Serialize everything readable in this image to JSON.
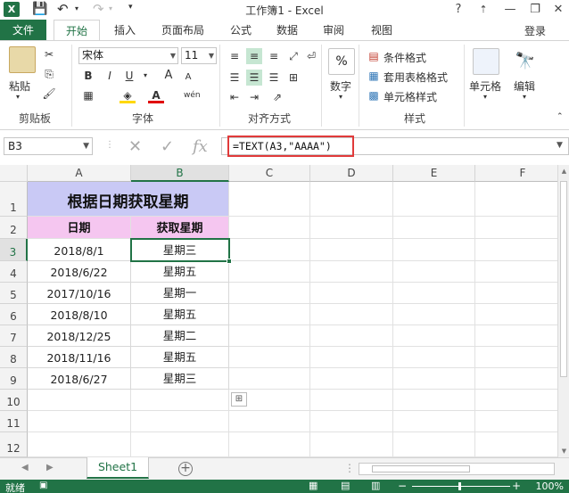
{
  "window": {
    "title": "工作簿1 - Excel",
    "help": "?",
    "minimize": "—",
    "restore": "❐",
    "close": "✕"
  },
  "tabs": {
    "file": "文件",
    "items": [
      "开始",
      "插入",
      "页面布局",
      "公式",
      "数据",
      "审阅",
      "视图"
    ],
    "active": "开始",
    "login": "登录"
  },
  "ribbon": {
    "clipboard": {
      "label": "剪贴板",
      "paste": "粘贴"
    },
    "font": {
      "label": "字体",
      "name": "宋体",
      "size": "11",
      "bold": "B",
      "italic": "I",
      "underline": "U",
      "grow": "A",
      "shrink": "A",
      "font_color": "A",
      "phonetic": "wén"
    },
    "alignment": {
      "label": "对齐方式"
    },
    "number": {
      "label": "数字",
      "button": "数字",
      "percent": "%"
    },
    "styles": {
      "label": "样式",
      "conditional": "条件格式",
      "table": "套用表格格式",
      "cell": "单元格样式"
    },
    "cells": {
      "label": "单元格"
    },
    "editing": {
      "label": "编辑"
    }
  },
  "formula_bar": {
    "name_box": "B3",
    "cancel": "✕",
    "enter": "✓",
    "fx": "fx",
    "formula": "=TEXT(A3,\"AAAA\")"
  },
  "grid": {
    "columns": [
      "A",
      "B",
      "C",
      "D",
      "E",
      "F"
    ],
    "rows": [
      "1",
      "2",
      "3",
      "4",
      "5",
      "6",
      "7",
      "8",
      "9",
      "10",
      "11",
      "12"
    ],
    "selected_col": "B",
    "selected_row": "3",
    "title": "根据日期获取星期",
    "header_date": "日期",
    "header_weekday": "获取星期",
    "data": [
      {
        "date": "2018/8/1",
        "weekday": "星期三"
      },
      {
        "date": "2018/6/22",
        "weekday": "星期五"
      },
      {
        "date": "2017/10/16",
        "weekday": "星期一"
      },
      {
        "date": "2018/8/10",
        "weekday": "星期五"
      },
      {
        "date": "2018/12/25",
        "weekday": "星期二"
      },
      {
        "date": "2018/11/16",
        "weekday": "星期五"
      },
      {
        "date": "2018/6/27",
        "weekday": "星期三"
      }
    ]
  },
  "sheets": {
    "tabs": [
      "Sheet1"
    ],
    "add": "+"
  },
  "status": {
    "ready": "就绪",
    "zoom": "100%"
  },
  "colors": {
    "accent": "#217346",
    "title_fill": "#c9c9f5",
    "header_fill": "#f5c6f0",
    "highlight_border": "#e03a3a"
  }
}
